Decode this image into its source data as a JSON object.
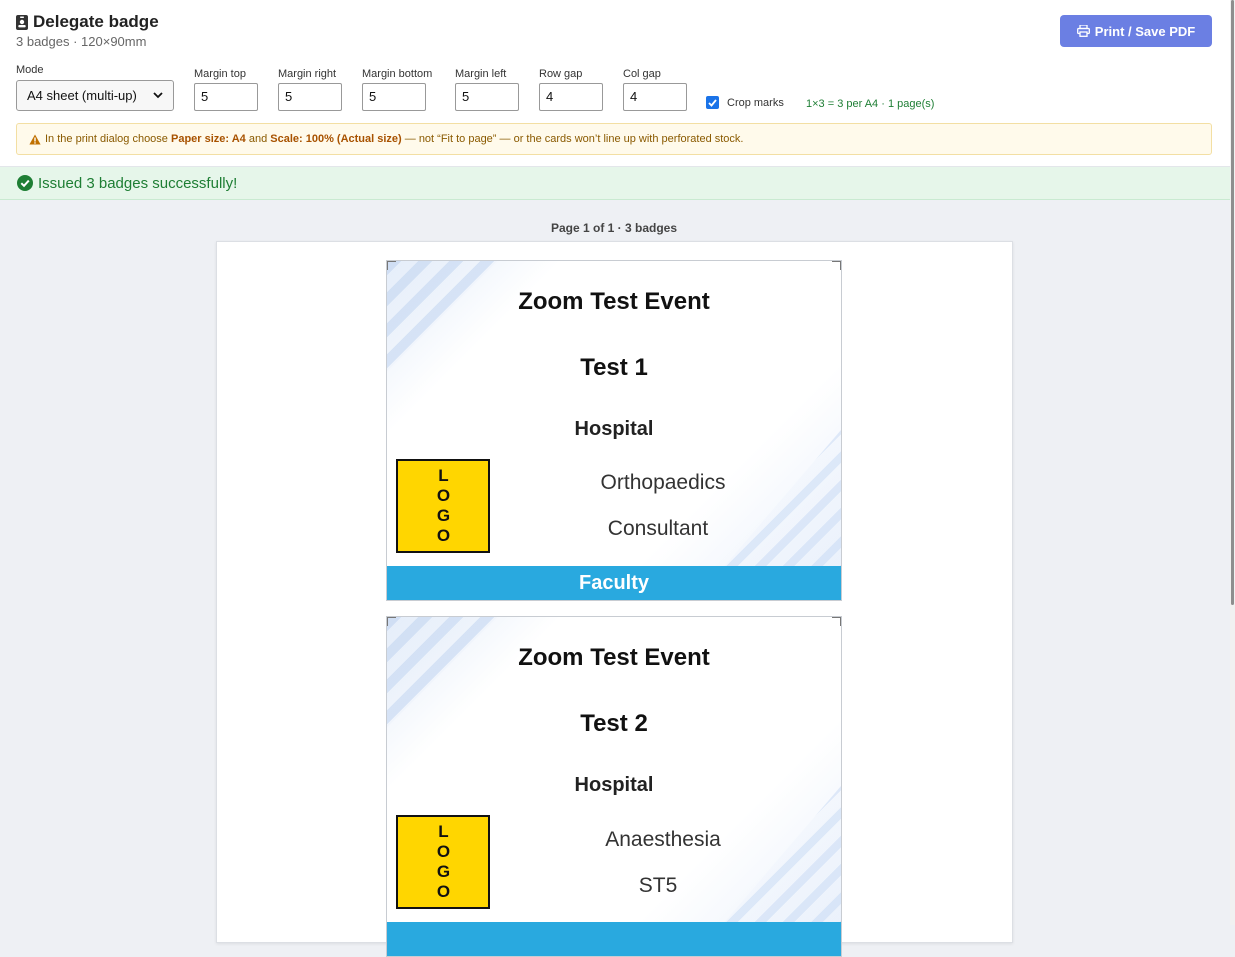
{
  "header": {
    "title": "Delegate badge",
    "subtitle": "3 badges · 120×90mm",
    "print_label": "Print / Save PDF"
  },
  "controls": {
    "mode": {
      "label": "Mode",
      "value": "A4 sheet (multi-up)"
    },
    "margin_top": {
      "label": "Margin top",
      "value": "5"
    },
    "margin_right": {
      "label": "Margin right",
      "value": "5"
    },
    "margin_bottom": {
      "label": "Margin bottom",
      "value": "5"
    },
    "margin_left": {
      "label": "Margin left",
      "value": "5"
    },
    "row_gap": {
      "label": "Row gap",
      "value": "4"
    },
    "col_gap": {
      "label": "Col gap",
      "value": "4"
    },
    "crop_marks": {
      "label": "Crop marks",
      "checked": true
    },
    "layout_info": "1×3 = 3 per A4 · 1 page(s)"
  },
  "warning": {
    "pre": "In the print dialog choose ",
    "paper_label": "Paper size: A4",
    "and": " and ",
    "scale_label": "Scale: 100% (Actual size)",
    "post": " — not “Fit to page” — or the cards won’t line up with perforated stock."
  },
  "success": {
    "text": "Issued 3 badges successfully!"
  },
  "preview": {
    "page_caption": "Page 1 of 1 · 3 badges",
    "badges": [
      {
        "event": "Zoom Test Event",
        "name": "Test 1",
        "organisation": "Hospital",
        "department": "Orthopaedics",
        "role": "Consultant",
        "category": "Faculty",
        "logo_text": "LOGO"
      },
      {
        "event": "Zoom Test Event",
        "name": "Test 2",
        "organisation": "Hospital",
        "department": "Anaesthesia",
        "role": "ST5",
        "category": "",
        "logo_text": "LOGO"
      }
    ]
  },
  "colors": {
    "primary": "#6b7fe3",
    "success": "#1e7e34",
    "warning": "#8a5a00",
    "badge_band": "#29a9df",
    "logo": "#ffd600"
  },
  "icons": {
    "title": "id-badge-icon",
    "print": "printer-icon",
    "warning": "warning-triangle-icon",
    "success": "check-circle-icon"
  }
}
